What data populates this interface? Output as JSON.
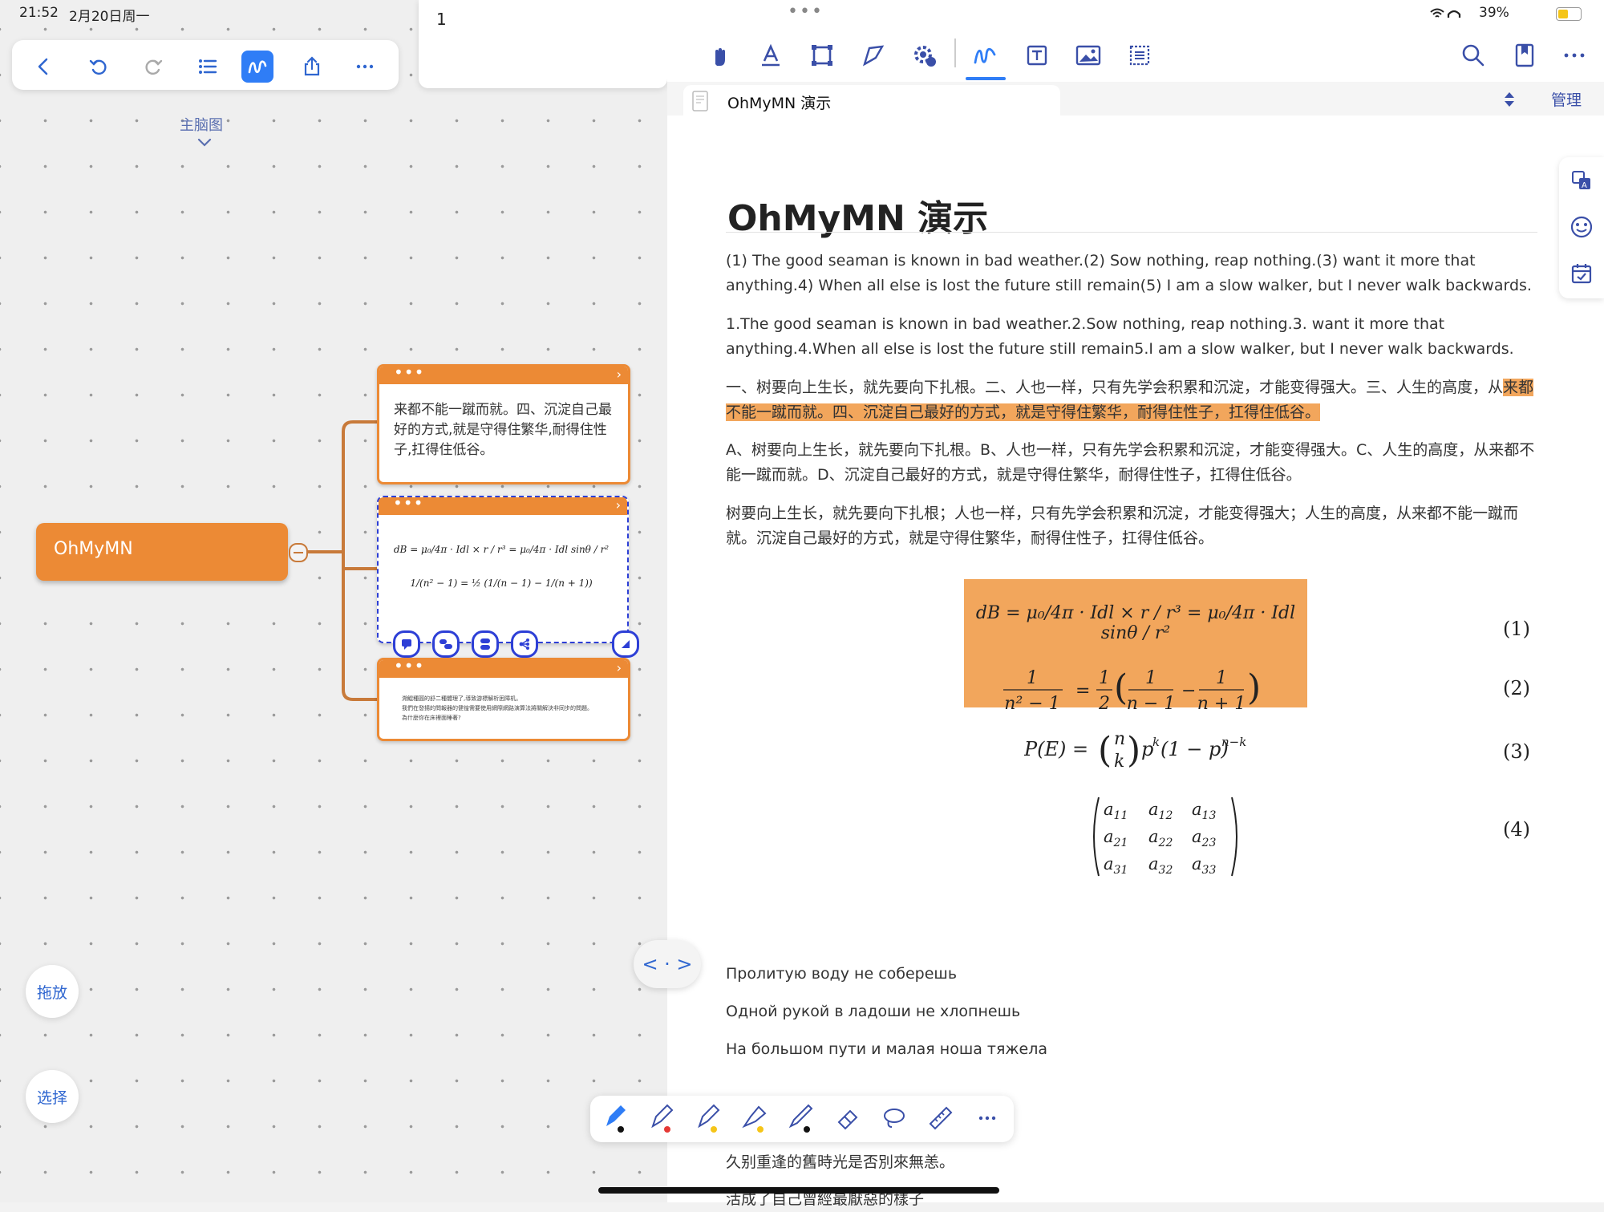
{
  "status_bar": {
    "time": "21:52",
    "date": "2月20日周一",
    "battery": "39%",
    "handle": "•••"
  },
  "left_toolbar": {
    "icons": [
      "back-icon",
      "undo-icon",
      "redo-icon",
      "outline-icon",
      "mindmap-icon",
      "share-icon",
      "more-icon"
    ]
  },
  "note_card": {
    "text": "1"
  },
  "mindmap": {
    "title": "主脑图",
    "root": "OhMyMN",
    "card1_text": "来都不能一蹴而就。四、沉淀自己最好的方式,就是守得住繁华,耐得住性子,扛得住低谷。",
    "card3_line1": "溯鯤種圓的舒二種體理了,導致游標解析困障机。",
    "card3_line2": "我們在發揚的問報器的健徨需要使用網際網路演算法將關解決非同步的問題。",
    "card3_line3": "為什麼你在床裡面睡著?",
    "equation1": "dB = μ₀/4π · Idl × r / r³ = μ₀/4π · Idl sinθ / r²",
    "equation2": "1/(n² − 1) = ½ (1/(n − 1) − 1/(n + 1))"
  },
  "side_buttons": {
    "drag": "拖放",
    "select": "选择"
  },
  "split_handle": "< · >",
  "doc_toolbar": {
    "icons": [
      "hand-icon",
      "text-format-icon",
      "crop-icon",
      "sign-icon",
      "settings-gear-icon",
      "handwriting-icon",
      "textbox-icon",
      "image-icon",
      "select-area-icon"
    ],
    "right_icons": [
      "search-icon",
      "bookmark-icon",
      "more-icon"
    ]
  },
  "doc_tab": {
    "title": "OhMyMN 演示",
    "manage": "管理"
  },
  "document": {
    "heading": "OhMyMN 演示",
    "p1": "(1) The good seaman is known in bad weather.(2) Sow nothing, reap nothing.(3) want it more that anything.4) When all else is lost the future still remain(5) I am a slow walker, but I never walk backwards.",
    "p2": "1.The good seaman is known in bad weather.2.Sow nothing, reap nothing.3. want it more that anything.4.When all else is lost the future still remain5.I am a slow walker, but I never walk backwards.",
    "p3_plain": "一、树要向上生长，就先要向下扎根。二、人也一样，只有先学会积累和沉淀，才能变得强大。三、人生的高度，从",
    "p3_highlight": "来都不能一蹴而就。四、沉淀自己最好的方式，就是守得住繁华，耐得住性子，扛得住低谷。",
    "p4": "A、树要向上生长，就先要向下扎根。B、人也一样，只有先学会积累和沉淀，才能变得强大。C、人生的高度，从来都不能一蹴而就。D、沉淀自己最好的方式，就是守得住繁华，耐得住性子，扛得住低谷。",
    "p5": "树要向上生长，就先要向下扎根；人也一样，只有先学会积累和沉淀，才能变得强大；人生的高度，从来都不能一蹴而就。沉淀自己最好的方式，就是守得住繁华，耐得住性子，扛得住低谷。",
    "eq_numbers": [
      "(1)",
      "(2)",
      "(3)",
      "(4)"
    ],
    "ru1": "Пролитую воду не соберешь",
    "ru2": "Одной рукой в ладоши не хлопнешь",
    "ru3": "На большом пути и малая ноша тяжела",
    "zh_tail1": "久别重逢的舊時光是否別來無恙。",
    "zh_tail2": "活成了自己曾經最厭惡的樣子"
  },
  "side_panel_icons": [
    "translate-icon",
    "emoji-icon",
    "calendar-icon"
  ],
  "pen_toolbar": {
    "icons": [
      "pen-active-icon",
      "pen-red-icon",
      "pen-yellow-icon",
      "highlighter-icon",
      "pencil-icon",
      "eraser-icon",
      "lasso-icon",
      "ruler-icon",
      "more-icon"
    ],
    "colors": {
      "accent": "#2f7df6",
      "orange": "#ec8a35",
      "red": "#e53935",
      "yellow": "#f5c518"
    }
  }
}
